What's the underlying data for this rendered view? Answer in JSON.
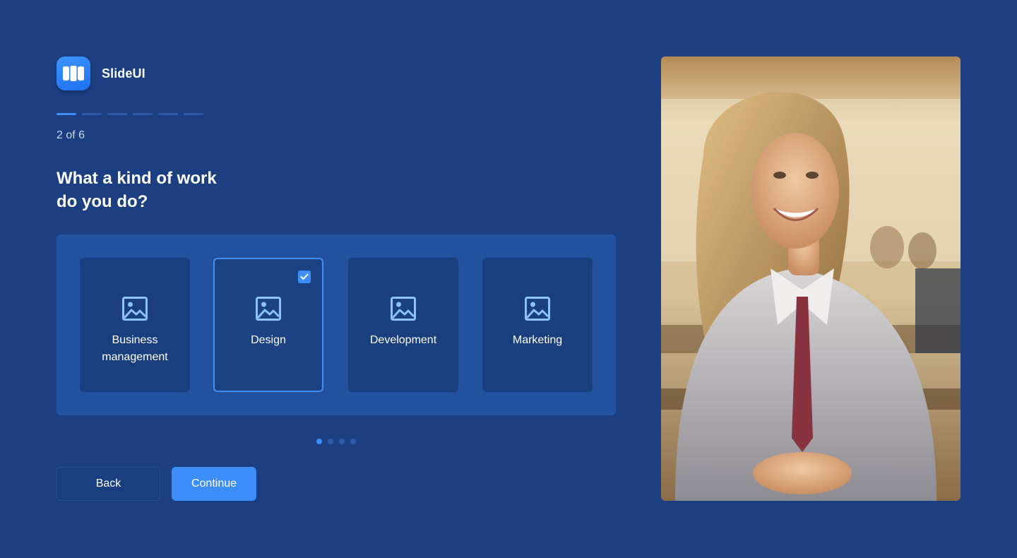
{
  "brand": {
    "name": "SlideUI",
    "logo_color": "#1d6ff2"
  },
  "progress": {
    "current": 2,
    "total": 6,
    "label": "2 of 6"
  },
  "question": {
    "line1": "What a kind of work",
    "line2": "do you do?"
  },
  "options": [
    {
      "label_line1": "Business",
      "label_line2": "management",
      "selected": false,
      "icon": "image-icon"
    },
    {
      "label_line1": "Design",
      "label_line2": "",
      "selected": true,
      "icon": "image-icon"
    },
    {
      "label_line1": "Development",
      "label_line2": "",
      "selected": false,
      "icon": "image-icon"
    },
    {
      "label_line1": "Marketing",
      "label_line2": "",
      "selected": false,
      "icon": "image-icon"
    }
  ],
  "pagination": {
    "pages": 4,
    "current": 1
  },
  "buttons": {
    "back": "Back",
    "continue": "Continue"
  },
  "colors": {
    "background": "#1b3f80",
    "accent": "#3d8ef8",
    "panel": "#22529e",
    "card": "#1a3f7f"
  }
}
